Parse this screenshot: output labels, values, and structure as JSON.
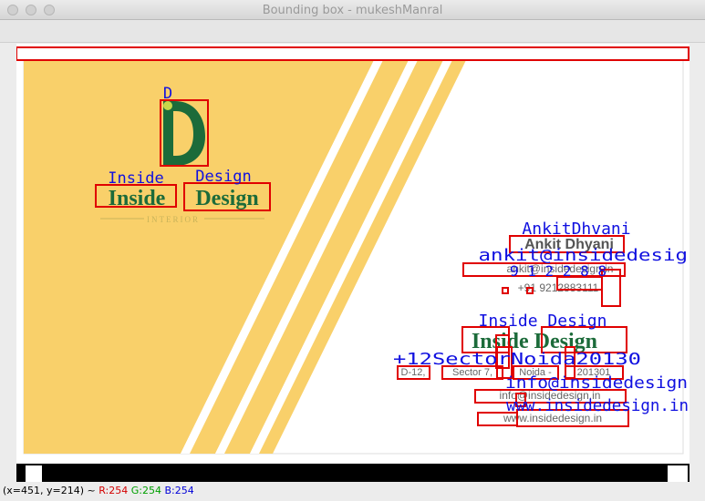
{
  "window": {
    "title": "Bounding box - mukeshManral"
  },
  "ocr_labels": {
    "logo_letter": "D",
    "logo_word1": "Inside",
    "logo_word2": "Design",
    "name": "AnkitDhvani",
    "email_line": "ankit@insidedesign",
    "phone_fragment": "9 1 2 2 8 8",
    "company_words": "Inside Design",
    "address_line": "+12SectorNoida20130",
    "info_line": "info@insidedesign",
    "web_line": "www.insidedesign.in"
  },
  "card": {
    "logo_letter": "D",
    "logo_word1": "Inside",
    "logo_word2": "Design",
    "logo_sub": "INTERIOR",
    "name": "Ankit Dhyani",
    "email": "ankit@insidedesign.in",
    "phone": "+91 9212883111",
    "company": "Inside Design",
    "address_parts": [
      "D-12,",
      "Sector 7,",
      "Noida -",
      "201301"
    ],
    "info": "info@insidedesign.in",
    "web": "www.insidedesign.in"
  },
  "status": {
    "coords": "(x=451, y=214) ~",
    "r": "R:254",
    "g": "G:254",
    "b": "B:254"
  },
  "colors": {
    "card_yellow": "#f9d06a",
    "logo_green": "#1c6b3a",
    "bbox_red": "#e00000",
    "ocr_blue": "#1010e0"
  }
}
